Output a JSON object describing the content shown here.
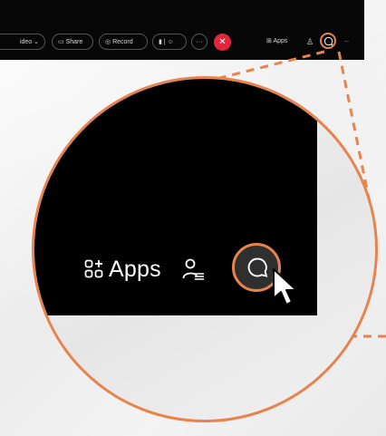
{
  "toolbar": {
    "video_label": "ideo",
    "video_caret": "⌄",
    "share_label": "Share",
    "record_label": "Record",
    "more_label": "···",
    "end_label": "✕",
    "apps_label": "Apps",
    "tail_label": "··"
  },
  "magnifier": {
    "apps_label": "Apps"
  },
  "colors": {
    "accent": "#e8834e",
    "end_call": "#e0273b",
    "toolbar_bg": "#070707"
  },
  "icons": [
    "apps-icon",
    "people-icon",
    "chat-icon",
    "mouse-cursor-icon",
    "share-icon",
    "record-icon",
    "microphone-icon"
  ]
}
